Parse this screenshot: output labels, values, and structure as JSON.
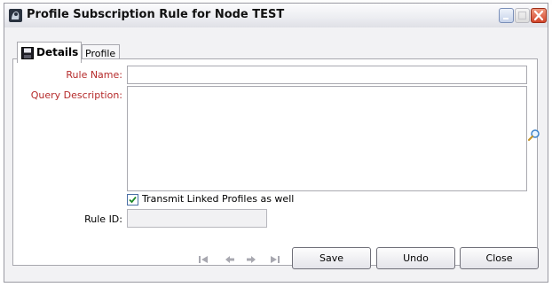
{
  "window": {
    "title": "Profile Subscription Rule for Node TEST"
  },
  "tabs": [
    {
      "label": "Details",
      "icon": "save-disk-icon",
      "selected": true
    },
    {
      "label": "Profile",
      "selected": false
    }
  ],
  "form": {
    "rule_name_label": "Rule Name:",
    "rule_name_value": "",
    "query_description_label": "Query Description:",
    "query_description_value": "",
    "transmit_checkbox_label": "Transmit Linked Profiles as well",
    "transmit_checked": true,
    "rule_id_label": "Rule ID:",
    "rule_id_value": ""
  },
  "footer": {
    "save_label": "Save",
    "undo_label": "Undo",
    "close_label": "Close"
  },
  "colors": {
    "required_label": "#b52a2a",
    "close_button": "#d3452b",
    "accent": "#4a6fa5"
  }
}
